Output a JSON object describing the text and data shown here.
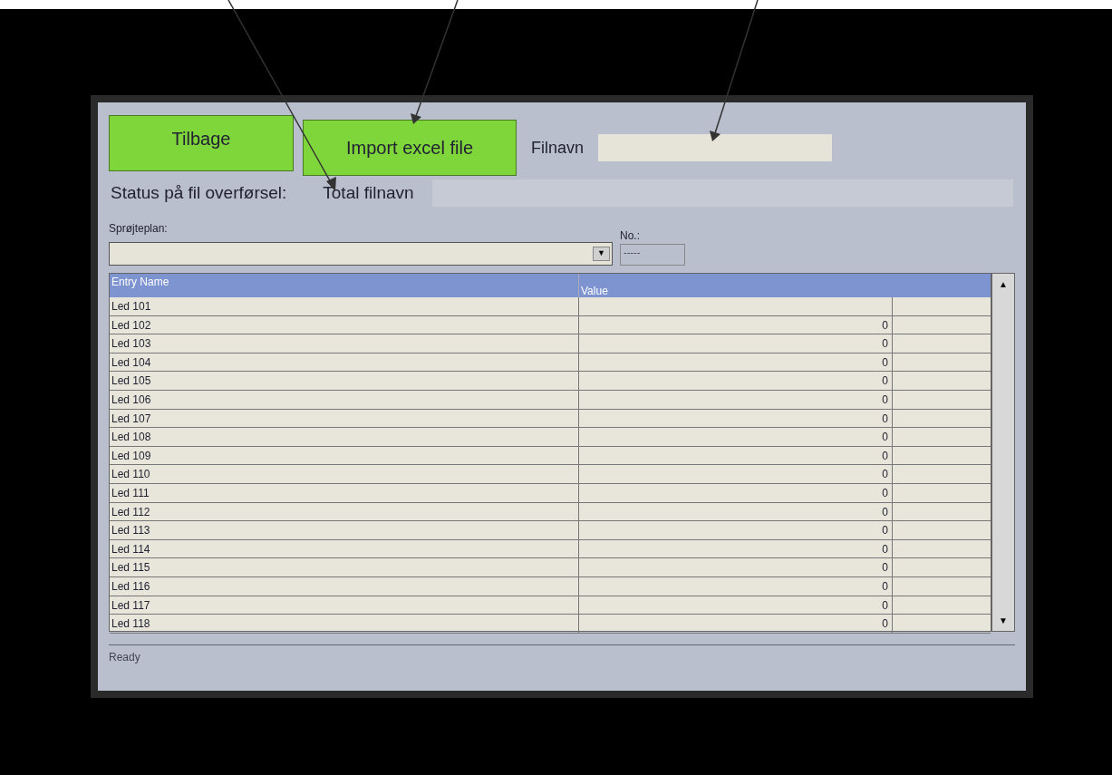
{
  "buttons": [
    {
      "label": "Tilbage"
    },
    {
      "label": "Import excel file"
    }
  ],
  "filename": {
    "label": "Filnavn"
  },
  "status": {
    "label": "Status på fil overførsel:"
  },
  "total_filename": {
    "label": "Total filnavn"
  },
  "plan": {
    "label": "Sprøjteplan:",
    "arrow": "▼"
  },
  "number": {
    "label": "No.:",
    "value": "-----"
  },
  "table": {
    "columns": [
      "Entry Name",
      "Value"
    ],
    "rows": [
      {
        "name": "Led 101",
        "value": ""
      },
      {
        "name": "Led 102",
        "value": "0"
      },
      {
        "name": "Led 103",
        "value": "0"
      },
      {
        "name": "Led 104",
        "value": "0"
      },
      {
        "name": "Led 105",
        "value": "0"
      },
      {
        "name": "Led 106",
        "value": "0"
      },
      {
        "name": "Led 107",
        "value": "0"
      },
      {
        "name": "Led 108",
        "value": "0"
      },
      {
        "name": "Led 109",
        "value": "0"
      },
      {
        "name": "Led 110",
        "value": "0"
      },
      {
        "name": "Led 111",
        "value": "0"
      },
      {
        "name": "Led 112",
        "value": "0"
      },
      {
        "name": "Led 113",
        "value": "0"
      },
      {
        "name": "Led 114",
        "value": "0"
      },
      {
        "name": "Led 115",
        "value": "0"
      },
      {
        "name": "Led 116",
        "value": "0"
      },
      {
        "name": "Led 117",
        "value": "0"
      },
      {
        "name": "Led 118",
        "value": "0"
      }
    ]
  },
  "scrollbar": {
    "up": "▲",
    "down": "▼"
  },
  "status_bar": "Ready"
}
